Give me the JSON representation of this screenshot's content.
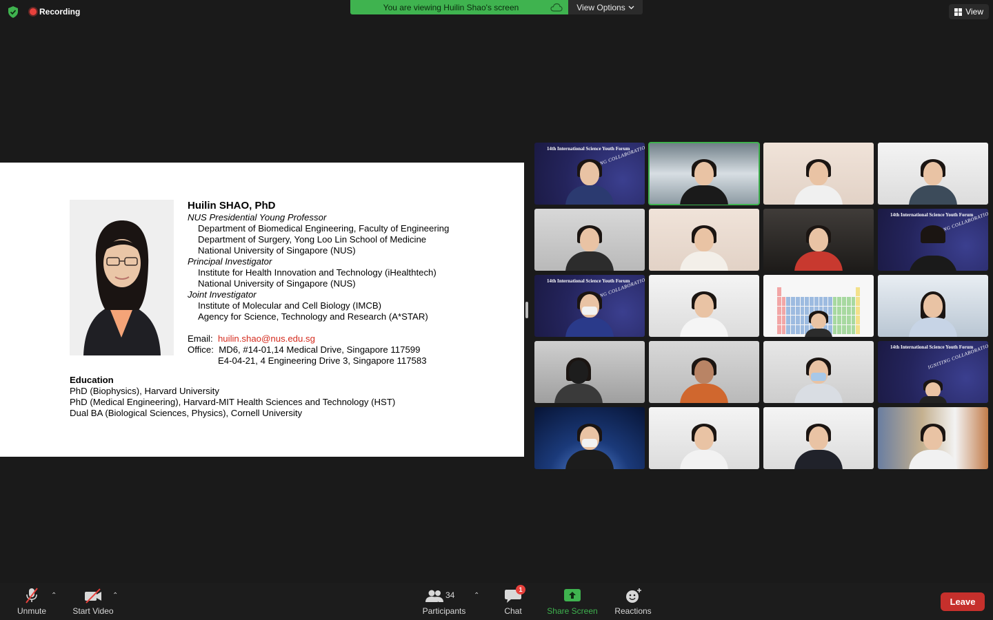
{
  "topbar": {
    "recording_label": "Recording",
    "viewing_banner": "You are viewing Huilin Shao's screen",
    "view_options_label": "View Options",
    "view_label": "View"
  },
  "slide": {
    "name": "Huilin SHAO, PhD",
    "role1": "NUS Presidential Young Professor",
    "role1_lines": [
      "Department of Biomedical Engineering, Faculty of Engineering",
      "Department of Surgery, Yong Loo Lin School of Medicine",
      "National University of Singapore (NUS)"
    ],
    "role2": "Principal Investigator",
    "role2_lines": [
      "Institute for Health Innovation and Technology (iHealthtech)",
      "National University of Singapore (NUS)"
    ],
    "role3": "Joint Investigator",
    "role3_lines": [
      "Institute of Molecular and Cell Biology (IMCB)",
      "Agency for Science, Technology and Research (A*STAR)"
    ],
    "email_label": "Email:",
    "email": "huilin.shao@nus.edu.sg",
    "office_label": "Office:",
    "office_line1": "MD6, #14-01,14 Medical Drive, Singapore 117599",
    "office_line2": "E4-04-21, 4 Engineering Drive 3, Singapore 117583",
    "education_heading": "Education",
    "education": [
      "PhD (Biophysics), Harvard University",
      "PhD (Medical Engineering), Harvard-MIT Health Sciences and Technology (HST)",
      "Dual BA (Biological Sciences, Physics), Cornell University"
    ]
  },
  "forum_banner": {
    "title": "14th International Science Youth Forum",
    "subtitle": "IGNITING COLLABORATION"
  },
  "toolbar": {
    "unmute": "Unmute",
    "start_video": "Start Video",
    "participants": "Participants",
    "participants_count": "34",
    "chat": "Chat",
    "chat_badge": "1",
    "share_screen": "Share Screen",
    "reactions": "Reactions",
    "leave": "Leave"
  },
  "colors": {
    "accent_green": "#3fb34f",
    "leave_red": "#c6302c",
    "email_red": "#d42b1e",
    "recording_red": "#e8413c"
  }
}
